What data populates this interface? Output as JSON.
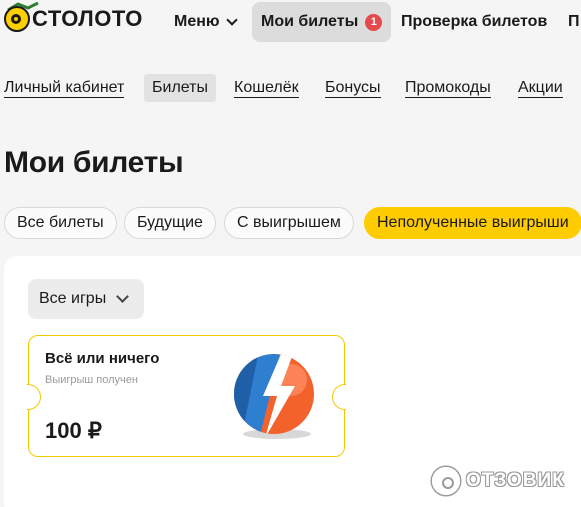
{
  "header": {
    "logo_text": "СТОЛОТО",
    "menu_label": "Меню",
    "my_tickets_label": "Мои билеты",
    "my_tickets_badge": "1",
    "check_tickets_label": "Проверка билетов",
    "cut_label": "П"
  },
  "subnav": {
    "items": [
      {
        "label": "Личный кабинет"
      },
      {
        "label": "Билеты",
        "active": true
      },
      {
        "label": "Кошелёк"
      },
      {
        "label": "Бонусы"
      },
      {
        "label": "Промокоды"
      },
      {
        "label": "Акции"
      }
    ]
  },
  "page": {
    "title": "Мои билеты"
  },
  "filters": {
    "items": [
      {
        "label": "Все билеты"
      },
      {
        "label": "Будущие"
      },
      {
        "label": "С выигрышем"
      },
      {
        "label": "Неполученные выигрыши",
        "active": true
      }
    ]
  },
  "games_filter": {
    "selected": "Все игры"
  },
  "ticket": {
    "game": "Всё или ничего",
    "status": "Выигрыш получен",
    "amount": "100 ₽"
  },
  "watermark": {
    "text": "ОТЗОВИК"
  },
  "colors": {
    "accent": "#ffcc00",
    "badge": "#e5484d",
    "ticket_border": "#f2c900",
    "ball_blue": "#2f7fd1",
    "ball_orange": "#f4622c"
  }
}
